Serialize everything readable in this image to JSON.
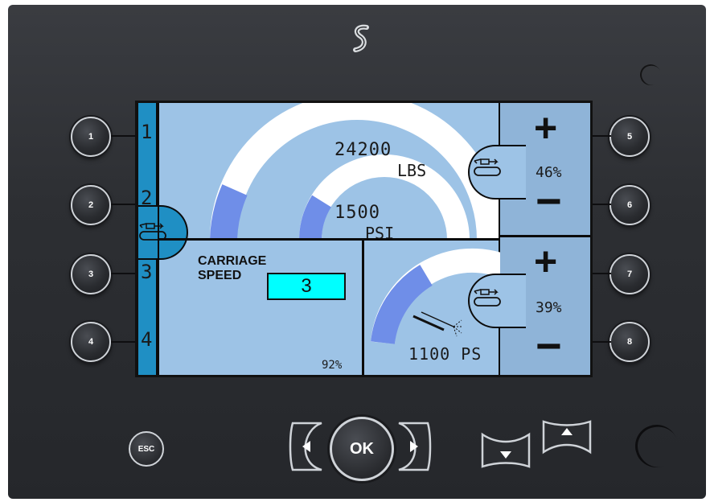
{
  "brand": {
    "logo": "S-logo"
  },
  "softkeys": [
    "1",
    "2",
    "3",
    "4",
    "5",
    "6",
    "7",
    "8"
  ],
  "sidebar": {
    "numbers": [
      "1",
      "2",
      "3",
      "4"
    ]
  },
  "gauges": {
    "main_value": "24200",
    "main_unit": "LBS",
    "inner_value": "1500",
    "inner_unit": "PSI",
    "small_value": "1100 PS"
  },
  "carriage": {
    "title_line1": "CARRIAGE",
    "title_line2": "SPEED",
    "speed": "3",
    "percent": "92%"
  },
  "right_controls": [
    {
      "plus": "+",
      "minus": "−",
      "percent": "46%"
    },
    {
      "plus": "+",
      "minus": "−",
      "percent": "39%"
    }
  ],
  "nav": {
    "esc": "ESC",
    "ok": "OK"
  },
  "colors": {
    "lcd_bg": "#9dc3e6",
    "lcd_dark": "#8fb4d8",
    "sidebar": "#1f8fc4",
    "speed_box": "#00ffff",
    "arc_blue": "#6f8ee8",
    "arc_white": "#ffffff"
  }
}
